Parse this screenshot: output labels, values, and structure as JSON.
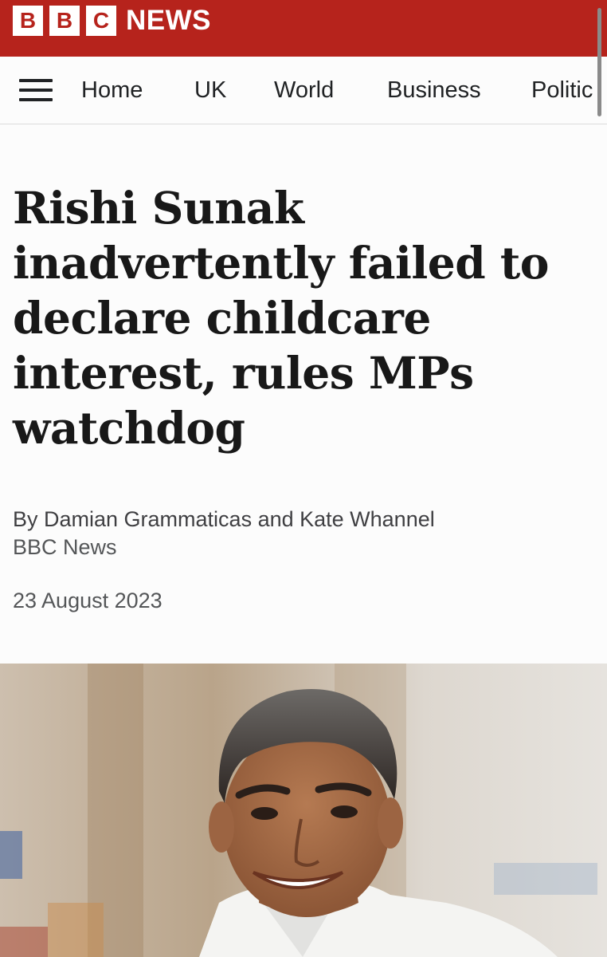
{
  "brand": {
    "letters": [
      "B",
      "B",
      "C"
    ],
    "name": "NEWS",
    "color": "#b6231c"
  },
  "nav": {
    "menu_icon": "hamburger-menu-icon",
    "items": [
      "Home",
      "UK",
      "World",
      "Business",
      "Politic"
    ]
  },
  "article": {
    "headline": "Rishi Sunak inadvertently failed to declare childcare interest, rules MPs watchdog",
    "byline": "By Damian Grammaticas and Kate Whannel",
    "source": "BBC News",
    "date": "23 August 2023"
  },
  "hero_image": {
    "subject": "portrait photo of a smiling man in a white shirt"
  }
}
